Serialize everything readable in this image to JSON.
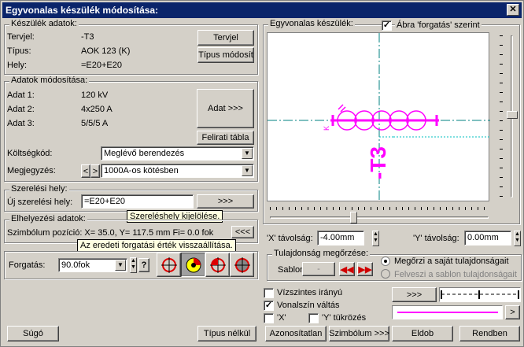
{
  "window": {
    "title": "Egyvonalas készülék módosítása:",
    "close": "✕"
  },
  "device_data": {
    "legend": "Készülék adatok:",
    "rows": [
      {
        "label": "Tervjel:",
        "value": "-T3"
      },
      {
        "label": "Típus:",
        "value": "AOK 123 (K)"
      },
      {
        "label": "Hely:",
        "value": "=E20+E20"
      }
    ],
    "tervjel_button": "Tervjel",
    "type_modify_button": "Típus módosít"
  },
  "data_modify": {
    "legend": "Adatok módosítása:",
    "rows": [
      {
        "label": "Adat 1:",
        "value": "120 kV"
      },
      {
        "label": "Adat 2:",
        "value": "4x250 A"
      },
      {
        "label": "Adat 3:",
        "value": "5/5/5 A"
      }
    ],
    "adat_button": "Adat >>>",
    "felirati_button": "Felirati tábla",
    "cost_label": "Költségkód:",
    "cost_value": "Meglévő berendezés",
    "note_label": "Megjegyzés:",
    "note_value": "1000A-os kötésben",
    "note_prev": "<",
    "note_next": ">"
  },
  "installation": {
    "legend": "Szerelési hely:",
    "new_label": "Új szerelési hely:",
    "new_value": "=E20+E20",
    "button": ">>>",
    "tooltip": "Szereléshely kijelölése."
  },
  "placement": {
    "legend": "Elhelyezési adatok:",
    "position_text": "Szimbólum pozíció: X=   35.0, Y= 117.5 mm Fi=     0.0 fok",
    "reset_button": "<<<",
    "tooltip": "Az eredeti forgatási érték visszaállítása."
  },
  "rotation": {
    "label": "Forgatás:",
    "value": "90.0fok",
    "help": "?"
  },
  "preview": {
    "legend": "Egyvonalas készülék:",
    "checkbox_label": "Ábra 'forgatás' szerint",
    "checked": true,
    "symbol_text": "-T3",
    "side_label": "K",
    "x_label": "'X' távolság:",
    "x_value": "-4.00mm",
    "y_label": "'Y' távolság:",
    "y_value": "0.00mm"
  },
  "property": {
    "legend": "Tulajdonság megőrzése:",
    "template_label": "Sablon:",
    "template_value": "-",
    "opt1": "Megőrzi a saját tulajdonságait",
    "opt2": "Felveszi a sablon tulajdonságait"
  },
  "options": {
    "horizontal": "Vízszintes irányú",
    "horizontal_checked": false,
    "linecolor": "Vonalszín váltás",
    "linecolor_checked": true,
    "x_mirror": "'X'",
    "x_checked": false,
    "y_mirror": "'Y' tükrözés",
    "y_checked": false,
    "more_button": ">>>",
    "arrow_button": ">"
  },
  "footer": {
    "help": "Súgó",
    "notype": "Típus nélkül",
    "identless": "Azonosítatlan",
    "symbol": "Szimbólum >>>",
    "drop": "Eldob",
    "ok": "Rendben"
  },
  "colors": {
    "symbol": "#ff00ff",
    "accent": "#e00000",
    "title": "#0a246a"
  }
}
